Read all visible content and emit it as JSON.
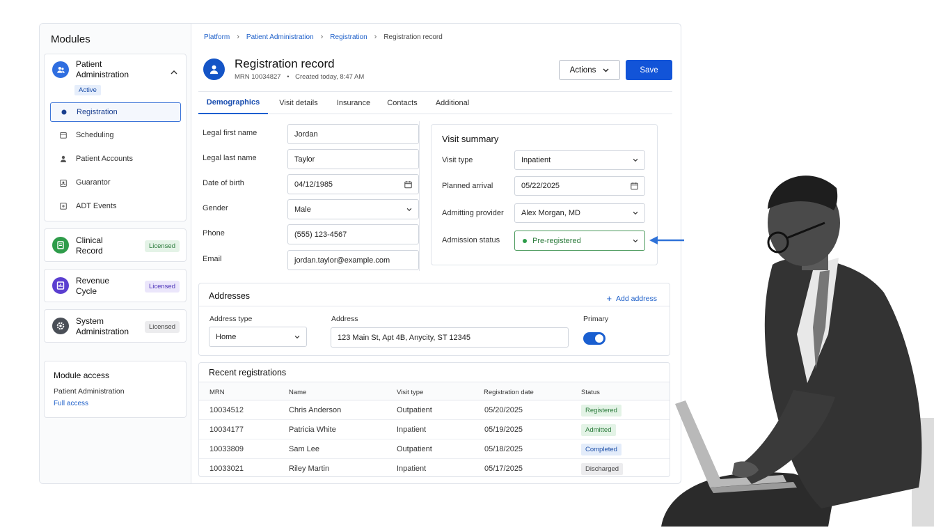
{
  "sidebar": {
    "title": "Modules",
    "patient_admin": {
      "title": "Patient Administration",
      "title_line1": "Patient",
      "title_line2": "Administration",
      "status": "Active"
    },
    "items": [
      {
        "label": "Registration",
        "icon": "dot-icon"
      },
      {
        "label": "Scheduling",
        "icon": "calendar-icon"
      },
      {
        "label": "Patient Accounts",
        "icon": "person-icon"
      },
      {
        "label": "Guarantor",
        "icon": "guarantor-icon"
      },
      {
        "label": "ADT Events",
        "icon": "adt-icon"
      }
    ],
    "modules": [
      {
        "line1": "Clinical",
        "line2": "Record",
        "badge": "Licensed",
        "color": "#2e9c4a"
      },
      {
        "line1": "Revenue",
        "line2": "Cycle",
        "badge": "Licensed",
        "color": "#5b3fd0"
      },
      {
        "line1": "System",
        "line2": "Administration",
        "badge": "Licensed",
        "color": "#4a4f57"
      }
    ],
    "access": {
      "title": "Module access",
      "module": "Patient Administration",
      "level": "Full access"
    }
  },
  "breadcrumb": [
    "Platform",
    "Patient Administration",
    "Registration",
    "Registration record"
  ],
  "record": {
    "title": "Registration record",
    "mrn": "MRN 10034827",
    "bullet": "•",
    "created": "Created today, 8:47 AM"
  },
  "toolbar": {
    "actions_label": "Actions",
    "save_label": "Save"
  },
  "tabs": [
    "Demographics",
    "Visit details",
    "Insurance",
    "Contacts",
    "Additional"
  ],
  "demographics": [
    {
      "label": "Legal first name",
      "value": "Jordan"
    },
    {
      "label": "Legal last name",
      "value": "Taylor"
    },
    {
      "label": "Date of birth",
      "value": "04/12/1985"
    },
    {
      "label": "Gender",
      "value": "Male"
    },
    {
      "label": "Phone",
      "value": "(555) 123-4567"
    },
    {
      "label": "Email",
      "value": "jordan.taylor@example.com"
    }
  ],
  "visit_summary": {
    "title": "Visit summary",
    "fields": [
      {
        "label": "Visit type",
        "value": "Inpatient"
      },
      {
        "label": "Planned arrival",
        "value": "05/22/2025"
      },
      {
        "label": "Admitting provider",
        "value": "Alex Morgan, MD"
      },
      {
        "label": "Admission status",
        "value": "Pre-registered"
      }
    ]
  },
  "addresses": {
    "title": "Addresses",
    "add_label": "Add address",
    "type_label": "Address type",
    "type_value": "Home",
    "address_label": "Address",
    "address_value": "123 Main St, Apt 4B, Anycity, ST 12345",
    "primary_label": "Primary",
    "primary": true
  },
  "recent": {
    "title": "Recent registrations",
    "columns": [
      "MRN",
      "Name",
      "Visit type",
      "Registration date",
      "Status"
    ],
    "rows": [
      {
        "mrn": "10034512",
        "name": "Chris Anderson",
        "visit": "Outpatient",
        "date": "05/20/2025",
        "status": "Registered",
        "status_color": "#e3f3e6",
        "status_text": "#2a7a3a"
      },
      {
        "mrn": "10034177",
        "name": "Patricia White",
        "visit": "Inpatient",
        "date": "05/19/2025",
        "status": "Admitted",
        "status_color": "#e3f3e6",
        "status_text": "#2a7a3a"
      },
      {
        "mrn": "10033809",
        "name": "Sam Lee",
        "visit": "Outpatient",
        "date": "05/18/2025",
        "status": "Completed",
        "status_color": "#e3ecfa",
        "status_text": "#1d4fa8"
      },
      {
        "mrn": "10033021",
        "name": "Riley Martin",
        "visit": "Inpatient",
        "date": "05/17/2025",
        "status": "Discharged",
        "status_color": "#ececee",
        "status_text": "#444"
      }
    ]
  },
  "colors": {
    "accent": "#1254d8",
    "success": "#2e9c4a"
  }
}
